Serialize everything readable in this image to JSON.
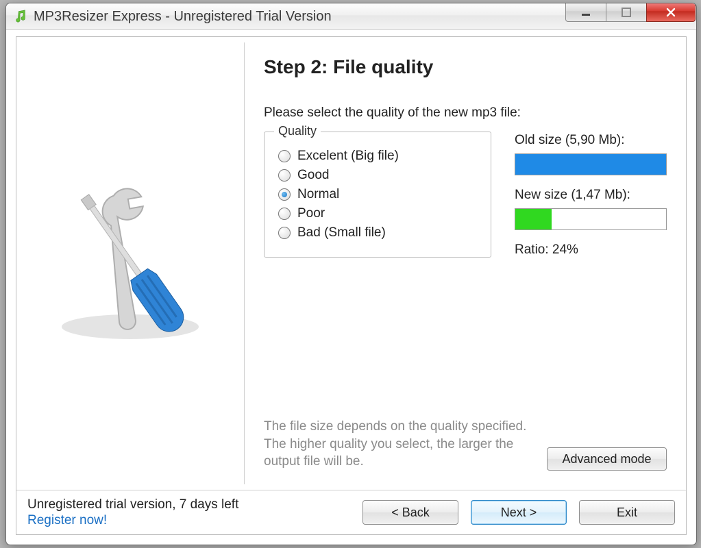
{
  "window": {
    "title": "MP3Resizer Express - Unregistered Trial Version"
  },
  "main": {
    "step_title": "Step 2: File quality",
    "instruction": "Please select the quality of the new mp3 file:",
    "quality_legend": "Quality",
    "quality_options": [
      "Excelent (Big file)",
      "Good",
      "Normal",
      "Poor",
      "Bad (Small file)"
    ],
    "quality_selected_index": 2,
    "old_size_label": "Old size (5,90 Mb):",
    "new_size_label": "New size (1,47 Mb):",
    "ratio_label": "Ratio: 24%",
    "ratio_percent": 24,
    "note": "The file size depends on the quality specified. The higher quality you select, the larger the output file will be.",
    "advanced_button": "Advanced mode"
  },
  "footer": {
    "trial_line": "Unregistered trial version, 7 days left",
    "register_link": "Register now!",
    "back_button": "< Back",
    "next_button": "Next >",
    "exit_button": "Exit"
  }
}
